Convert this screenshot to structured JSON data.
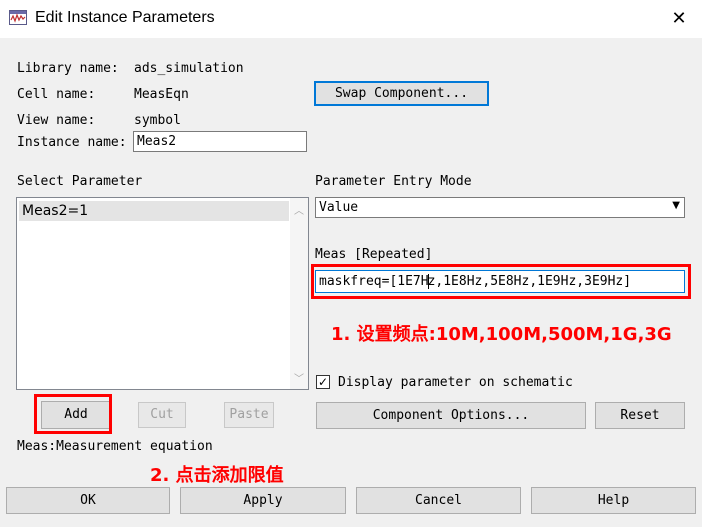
{
  "window": {
    "title": "Edit Instance Parameters",
    "close_glyph": "✕"
  },
  "info": {
    "library_label": "Library name:",
    "library_value": "ads_simulation",
    "cell_label": "Cell name:",
    "cell_value": "MeasEqn",
    "view_label": "View name:",
    "view_value": "symbol",
    "instance_label": "Instance name:",
    "instance_value": "Meas2"
  },
  "swap_button": "Swap Component...",
  "select_parameter": {
    "heading": "Select Parameter",
    "items": [
      "Meas2=1"
    ]
  },
  "entry_mode": {
    "heading": "Parameter Entry Mode",
    "value": "Value"
  },
  "meas": {
    "label": "Meas [Repeated]",
    "value_before_cursor": "maskfreq=[1E7H",
    "value_after_cursor": "z,1E8Hz,5E8Hz,1E9Hz,3E9Hz]"
  },
  "annotations": {
    "step1": "1. 设置频点:10M,100M,500M,1G,3G",
    "step2": "2. 点击添加限值",
    "color": "#ff0000"
  },
  "display_checkbox": {
    "checked": true,
    "check_glyph": "✓",
    "label": "Display parameter on schematic"
  },
  "edit_buttons": {
    "add": "Add",
    "cut": "Cut",
    "paste": "Paste"
  },
  "component_options_button": "Component Options...",
  "reset_button": "Reset",
  "description": "Meas:Measurement equation",
  "bottom_buttons": {
    "ok": "OK",
    "apply": "Apply",
    "cancel": "Cancel",
    "help": "Help"
  },
  "icons": {
    "scroll_up": "chevron-up-icon",
    "scroll_down": "chevron-down-icon",
    "combo": "triangle-down-icon"
  }
}
